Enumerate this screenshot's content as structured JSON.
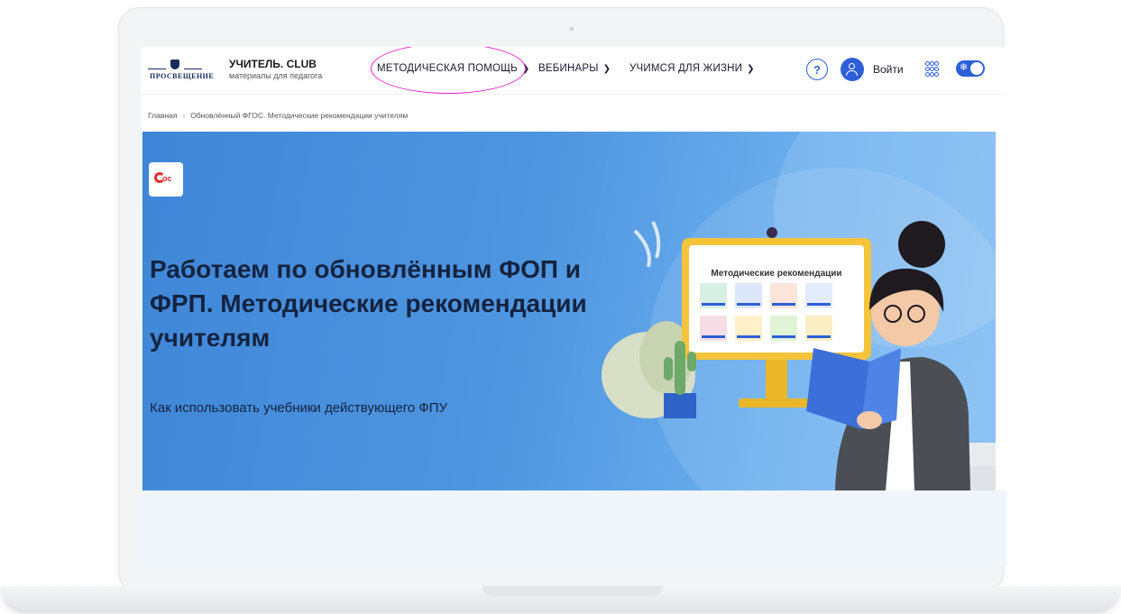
{
  "header": {
    "logo_text": "ПРОСВЕЩЕНИЕ",
    "club_title": "УЧИТЕЛЬ. CLUB",
    "club_subtitle": "материалы для педагога",
    "nav": [
      {
        "label": "МЕТОДИЧЕСКАЯ ПОМОЩЬ"
      },
      {
        "label": "ВЕБИНАРЫ"
      },
      {
        "label": "УЧИМСЯ ДЛЯ ЖИЗНИ"
      }
    ],
    "help_label": "?",
    "login_label": "Войти"
  },
  "breadcrumb": {
    "home": "Главная",
    "current": "Обновлённый ФГОС. Методические рекомендации учителям"
  },
  "hero": {
    "badge_text": "ос",
    "title": "Работаем по обновлённым ФОП и ФРП. Методические рекомендации учителям",
    "subtitle": "Как использовать учебники действующего ФПУ",
    "illustration": {
      "screen_title": "Методические рекомендации"
    }
  },
  "colors": {
    "accent": "#2d5fd8",
    "hero_bg": "#4f96e0",
    "highlight": "#e020c8",
    "title_text": "#14233f"
  }
}
